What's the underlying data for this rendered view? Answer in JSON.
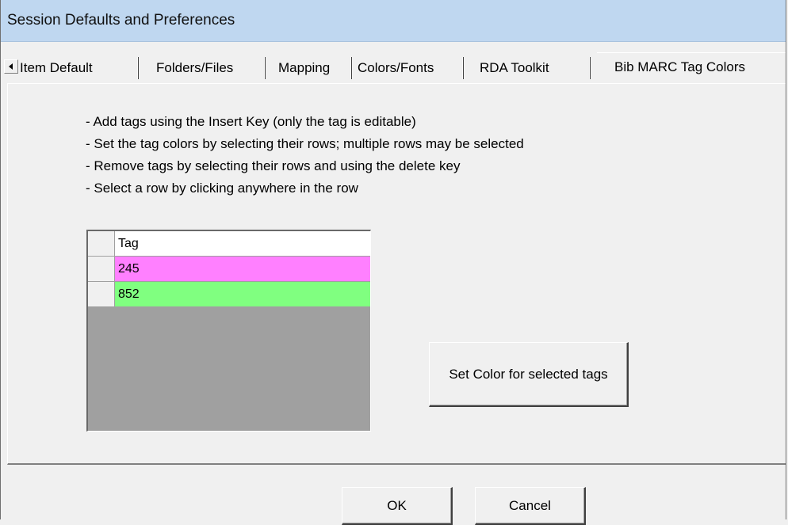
{
  "window": {
    "title": "Session Defaults and Preferences"
  },
  "tabs": [
    {
      "label": "Item Default"
    },
    {
      "label": "Folders/Files"
    },
    {
      "label": "Mapping"
    },
    {
      "label": "Colors/Fonts"
    },
    {
      "label": "RDA Toolkit"
    },
    {
      "label": "Bib MARC Tag Colors",
      "active": true
    }
  ],
  "instructions": [
    "- Add tags using the Insert Key (only the tag is editable)",
    "- Set the tag colors by selecting their rows; multiple rows may be selected",
    "- Remove tags by selecting their rows and using the delete key",
    "- Select a row by clicking anywhere in the row"
  ],
  "grid": {
    "header": "Tag",
    "rows": [
      {
        "tag": "245",
        "color": "#ff80ff"
      },
      {
        "tag": "852",
        "color": "#80ff80"
      }
    ],
    "header_color": "#ffffff",
    "empty_color": "#a0a0a0"
  },
  "buttons": {
    "set_color": "Set Color for selected tags",
    "ok": "OK",
    "cancel": "Cancel"
  }
}
